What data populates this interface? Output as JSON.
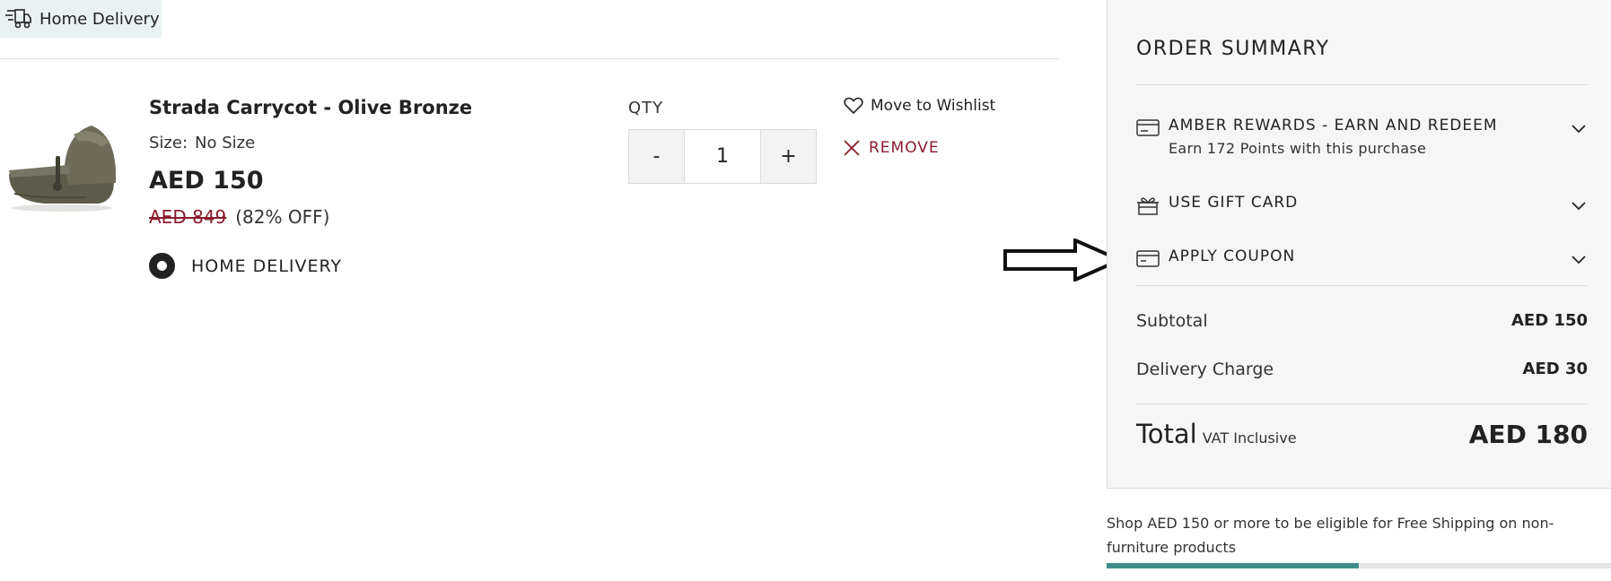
{
  "delivery_tab": {
    "label": "Home Delivery",
    "icon": "truck-icon"
  },
  "product": {
    "name": "Strada Carrycot - Olive Bronze",
    "size_label": "Size:",
    "size_value": "No Size",
    "price": "AED 150",
    "old_price": "AED 849",
    "discount": "(82% OFF)",
    "delivery_option": "HOME DELIVERY"
  },
  "quantity": {
    "label": "QTY",
    "value": "1",
    "decrement": "-",
    "increment": "+"
  },
  "actions": {
    "wishlist": "Move to Wishlist",
    "remove": "REMOVE"
  },
  "order_summary": {
    "title": "ORDER SUMMARY",
    "rewards": {
      "title": "AMBER REWARDS - EARN AND REDEEM",
      "subtitle": "Earn 172 Points with this purchase"
    },
    "gift_card": {
      "title": "USE GIFT CARD"
    },
    "coupon": {
      "title": "APPLY COUPON"
    },
    "subtotal": {
      "label": "Subtotal",
      "value": "AED 150"
    },
    "delivery_charge": {
      "label": "Delivery Charge",
      "value": "AED 30"
    },
    "total": {
      "label": "Total",
      "vat": "VAT Inclusive",
      "value": "AED 180"
    }
  },
  "shipping": {
    "message": "Shop AED 150 or more to be eligible for Free Shipping on non-furniture products",
    "progress": 0.5
  },
  "colors": {
    "accent": "#3e8d8b",
    "sale": "#8a1c2b",
    "summary_bg": "#f6f6f6"
  }
}
